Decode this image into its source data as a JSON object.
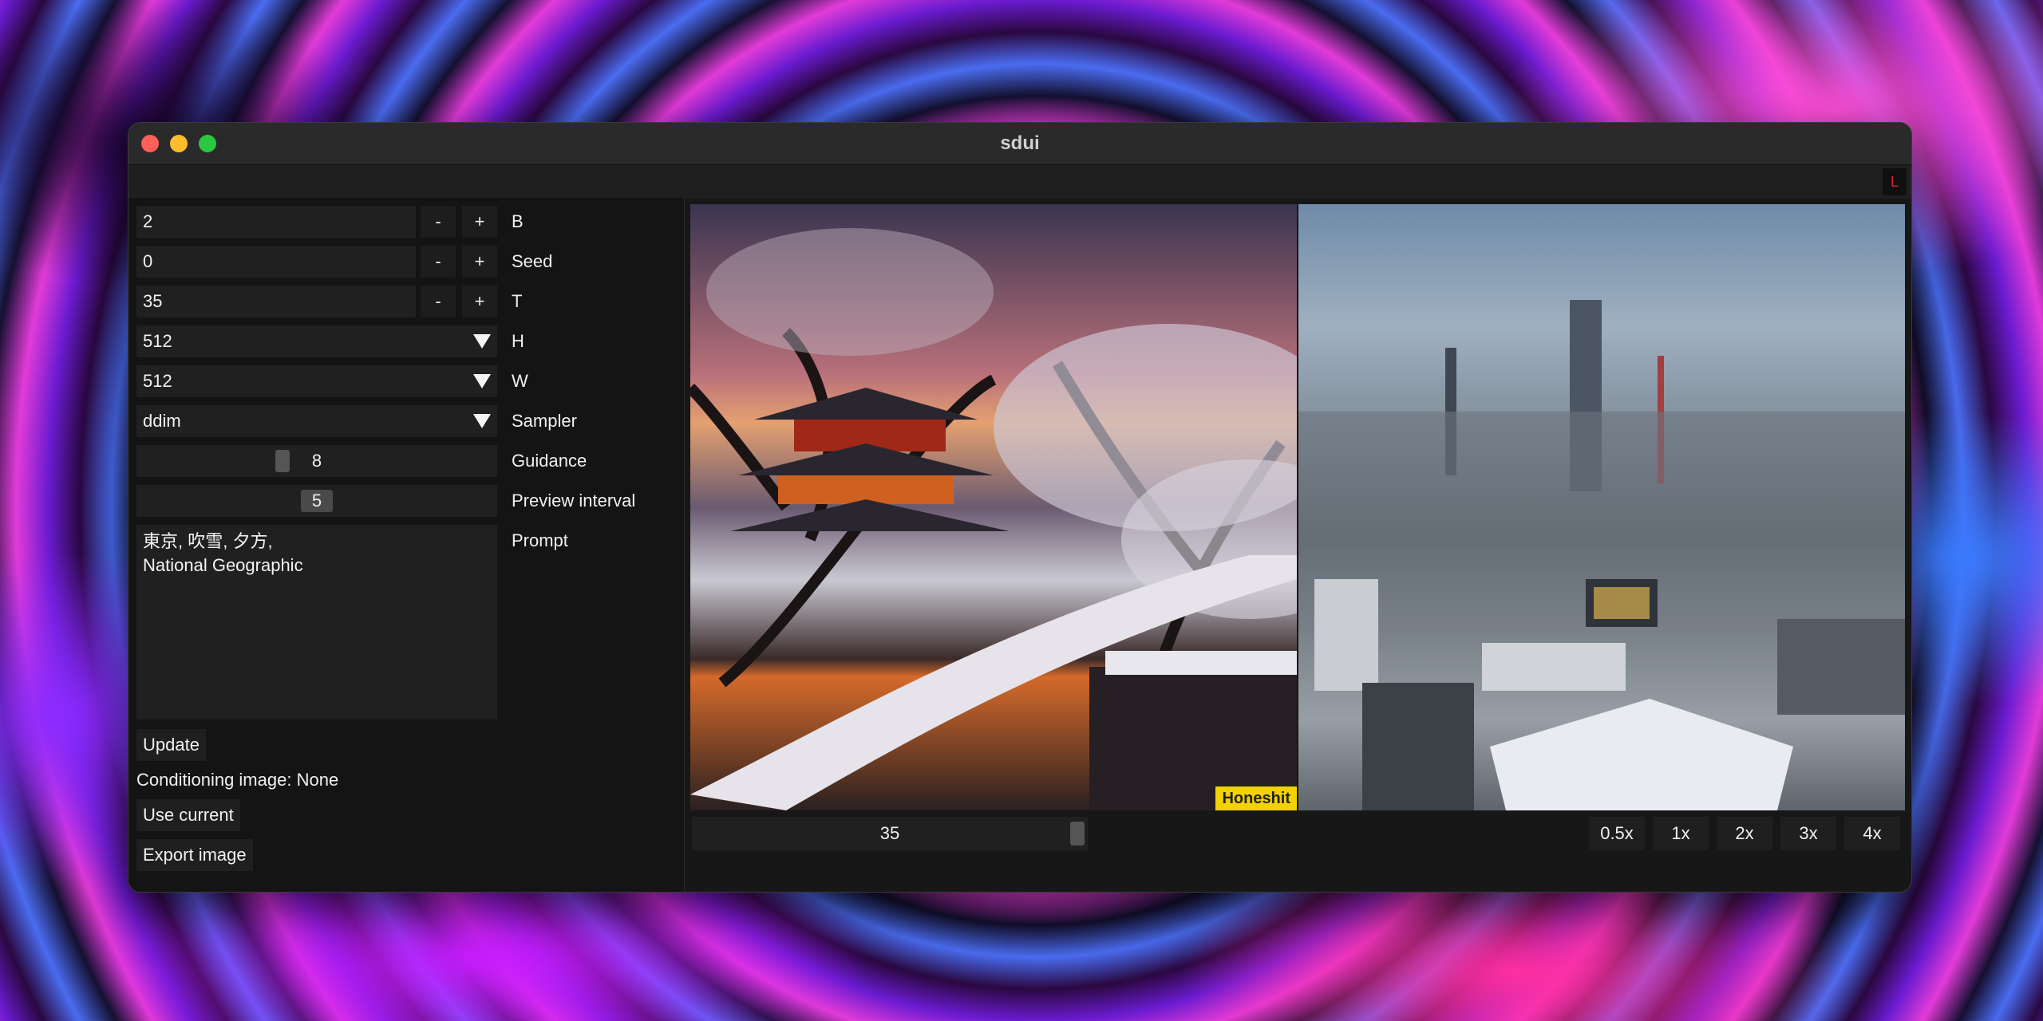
{
  "window": {
    "title": "sdui",
    "menu_badge": "L"
  },
  "controls": {
    "batch": {
      "value": "2",
      "label": "B"
    },
    "seed": {
      "value": "0",
      "label": "Seed"
    },
    "steps": {
      "value": "35",
      "label": "T"
    },
    "height": {
      "value": "512",
      "label": "H"
    },
    "width": {
      "value": "512",
      "label": "W"
    },
    "sampler": {
      "value": "ddim",
      "label": "Sampler"
    },
    "guidance": {
      "value": "8",
      "label": "Guidance"
    },
    "preview_interval": {
      "value": "5",
      "label": "Preview interval"
    },
    "prompt": {
      "value": "東京, 吹雪, 夕方,\nNational Geographic",
      "label": "Prompt"
    },
    "minus": "-",
    "plus": "+",
    "update_button": "Update",
    "conditioning_label": "Conditioning image:",
    "conditioning_value": "None",
    "use_current_button": "Use current",
    "export_button": "Export image"
  },
  "viewer": {
    "step_value": "35",
    "zoom_options": [
      "0.5x",
      "1x",
      "2x",
      "3x",
      "4x"
    ],
    "watermark": "Honeshit"
  },
  "colors": {
    "accent_close": "#fe5f57",
    "accent_min": "#febc2e",
    "accent_max": "#28c840",
    "watermark_bg": "#f2d200"
  }
}
